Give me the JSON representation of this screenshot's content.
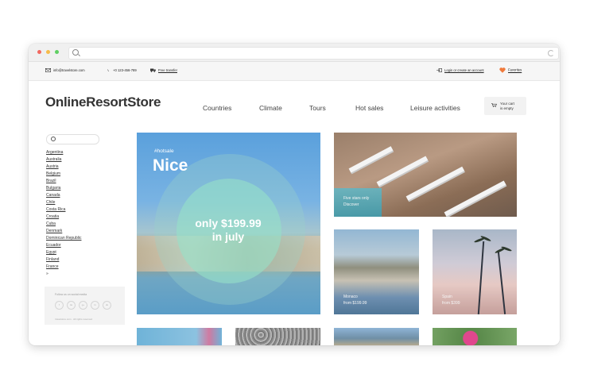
{
  "topbar": {
    "email": "info@travelstore.com",
    "phone": "+0 123-456-789",
    "transfer": "Free transfer",
    "login": "Login or create an account",
    "favorites": "Favorites"
  },
  "header": {
    "logo": "OnlineResortStore",
    "nav": [
      "Countries",
      "Climate",
      "Tours",
      "Hot sales",
      "Leisure activities"
    ],
    "cart_line1": "Your cart",
    "cart_line2": "is empty"
  },
  "sidebar": {
    "countries": [
      "Argentina",
      "Australia",
      "Austria",
      "Belgium",
      "Brazil",
      "Bulgaria",
      "Canada",
      "Chile",
      "Costa Rica",
      "Croatia",
      "Cuba",
      "Denmark",
      "Dominican Republic",
      "Ecuador",
      "Egypt",
      "Finland",
      "France"
    ],
    "more": "»",
    "social": {
      "follow": "Follow us on social media",
      "networks": [
        "f",
        "tw",
        "g+",
        "in",
        "vk"
      ],
      "copyright": "travelstore.com · All rights reserved"
    }
  },
  "tiles": {
    "hot": {
      "tag": "#hotsale",
      "name": "Nice",
      "price_line1": "only $199.99",
      "price_line2": "in july"
    },
    "pool": {
      "line1": "Five stars only",
      "line2": "Discover"
    },
    "monaco": {
      "line1": "Monaco",
      "line2": "from $199.99"
    },
    "palms": {
      "line1": "Spain",
      "line2": "from $399"
    }
  },
  "colors": {
    "heart": "#f07a3c",
    "text": "#333333"
  }
}
